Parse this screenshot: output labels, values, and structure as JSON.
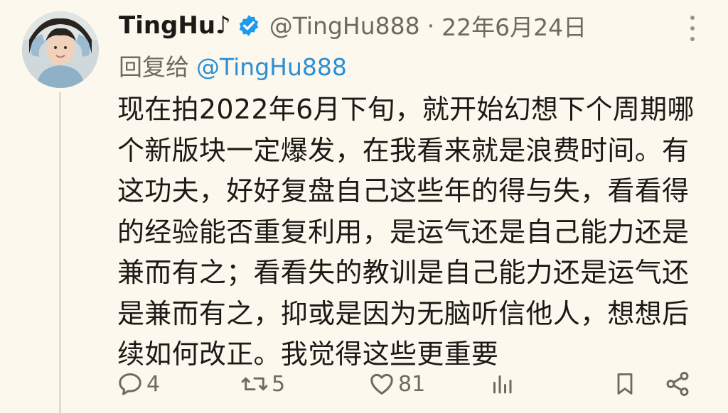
{
  "tweet": {
    "display_name": "TingHu♪",
    "handle": "@TingHu888",
    "separator": "·",
    "date": "22年6月24日",
    "reply_prefix": "回复给",
    "reply_to": "@TingHu888",
    "text": "现在拍2022年6月下旬，就开始幻想下个周期哪个新版块一定爆发，在我看来就是浪费时间。有这功夫，好好复盘自己这些年的得与失，看看得的经验能否重复利用，是运气还是自己能力还是兼而有之；看看失的教训是自己能力还是运气还是兼而有之，抑或是因为无脑听信他人，想想后续如何改正。我觉得这些更重要"
  },
  "actions": {
    "reply_count": "4",
    "retweet_count": "5",
    "like_count": "81"
  },
  "icons": {
    "verified": "verified-badge-icon",
    "more": "more-vertical-icon",
    "reply": "reply-icon",
    "retweet": "retweet-icon",
    "like": "heart-icon",
    "views": "analytics-icon",
    "bookmark": "bookmark-icon",
    "share": "share-icon"
  },
  "colors": {
    "background": "#fdf8ee",
    "mention": "#2c8fd4",
    "verified": "#1d9bf0",
    "muted": "#6e6a63"
  }
}
